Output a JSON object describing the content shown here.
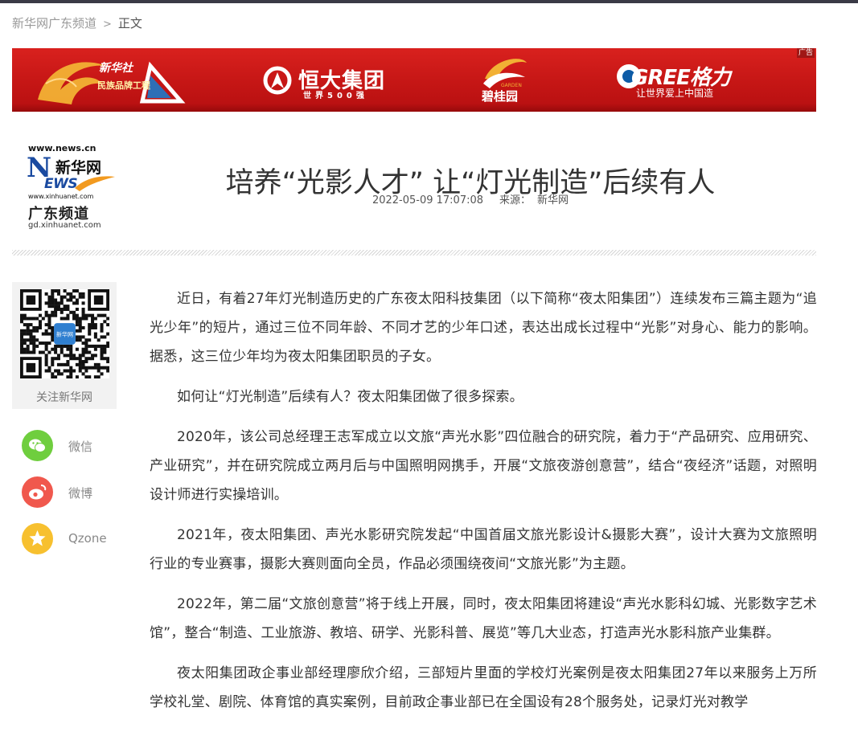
{
  "breadcrumb": {
    "site": "新华网广东频道",
    "separator": ">",
    "current": "正文"
  },
  "banner": {
    "ad_tag": "广告",
    "xinhua_brand": "新华社",
    "xinhua_project": "民族品牌工程",
    "hengda_name": "恒大集团",
    "hengda_sub": "世界500强",
    "bgy_name": "碧桂园",
    "bgy_en": "GARDEN",
    "gree_name": "GREE格力",
    "gree_sub": "让世界爱上中国造",
    "colors": {
      "background": "#c51615",
      "accent": "#f2b134"
    }
  },
  "logo": {
    "url_top": "www.news.cn",
    "n_letter": "N",
    "ews_letters": "EWS",
    "brand": "新华网",
    "url_mid": "www.xinhuanet.com",
    "channel": "广东频道",
    "url_bottom": "gd.xinhuanet.com"
  },
  "article": {
    "title": "培养“光影人才” 让“灯光制造”后续有人",
    "date": "2022-05-09 17:07:08",
    "source_label": "来源：",
    "source": "新华网",
    "paragraphs": [
      "近日，有着27年灯光制造历史的广东夜太阳科技集团（以下简称“夜太阳集团”）连续发布三篇主题为“追光少年”的短片，通过三位不同年龄、不同才艺的少年口述，表达出成长过程中“光影”对身心、能力的影响。据悉，这三位少年均为夜太阳集团职员的子女。",
      "如何让“灯光制造”后续有人？夜太阳集团做了很多探索。",
      "2020年，该公司总经理王志军成立以文旅“声光水影”四位融合的研究院，着力于“产品研究、应用研究、产业研究”，并在研究院成立两月后与中国照明网携手，开展“文旅夜游创意营”，结合“夜经济”话题，对照明设计师进行实操培训。",
      "2021年，夜太阳集团、声光水影研究院发起“中国首届文旅光影设计&摄影大赛”，设计大赛为文旅照明行业的专业赛事，摄影大赛则面向全员，作品必须围绕夜间“文旅光影”为主题。",
      "2022年，第二届“文旅创意营”将于线上开展，同时，夜太阳集团将建设“声光水影科幻城、光影数字艺术馆”，整合“制造、工业旅游、教培、研学、光影科普、展览”等几大业态，打造声光水影科旅产业集群。",
      "夜太阳集团政企事业部经理廖欣介绍，三部短片里面的学校灯光案例是夜太阳集团27年以来服务上万所学校礼堂、剧院、体育馆的真实案例，目前政企事业部已在全国设有28个服务处，记录灯光对教学"
    ]
  },
  "sidebar": {
    "qr_label": "关注新华网",
    "share": [
      {
        "label": "微信",
        "icon": "wechat-icon",
        "color": "#6fce3e"
      },
      {
        "label": "微博",
        "icon": "weibo-icon",
        "color": "#f0584d"
      },
      {
        "label": "Qzone",
        "icon": "qzone-icon",
        "color": "#f7c02f"
      }
    ]
  }
}
